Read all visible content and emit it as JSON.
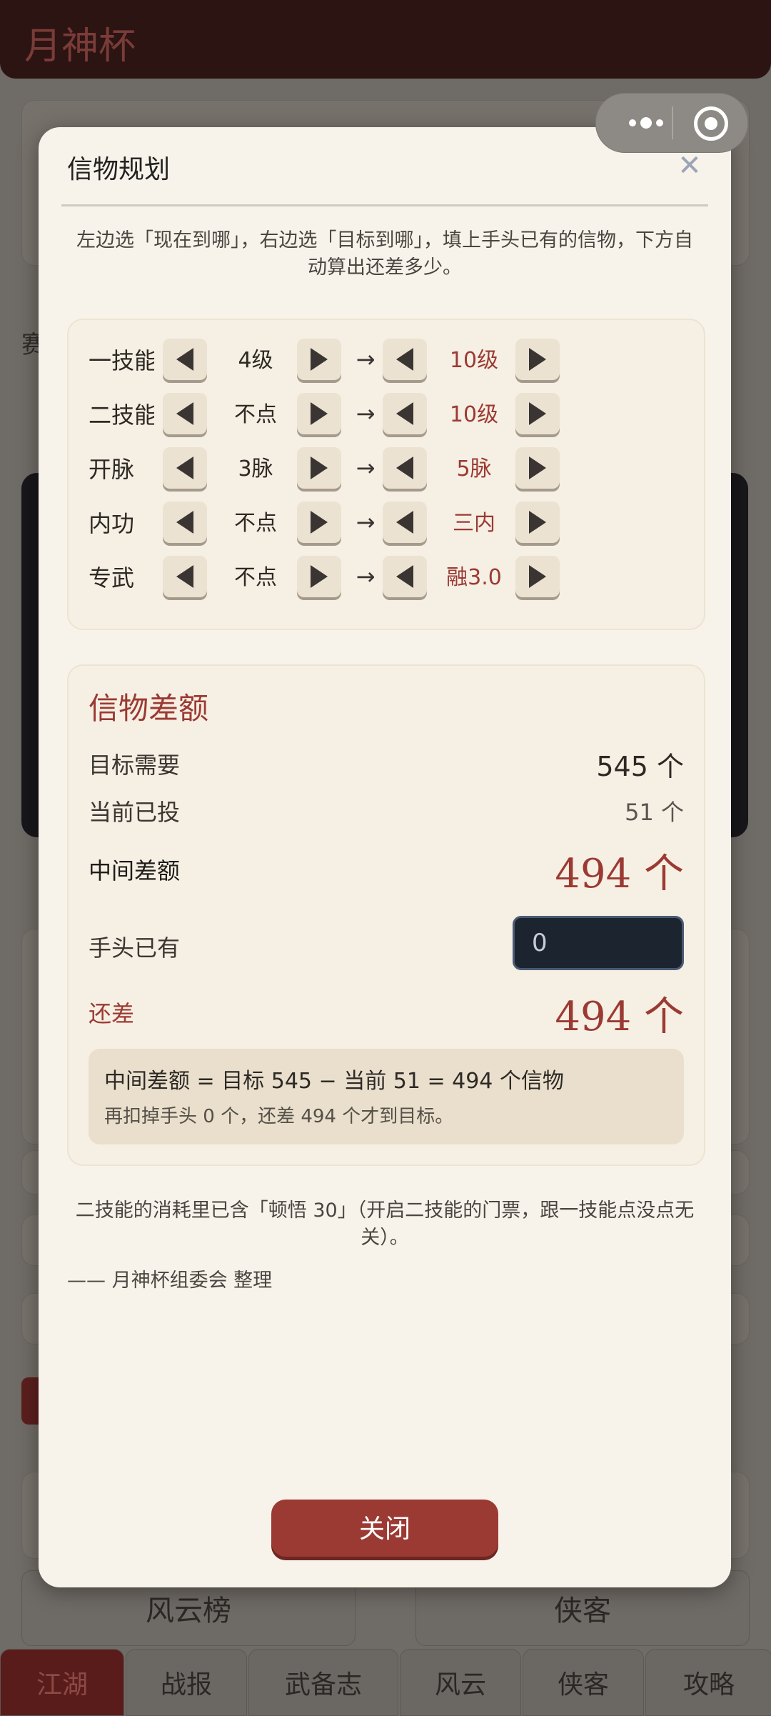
{
  "app": {
    "title": "月神杯",
    "side_fragment": "赛",
    "bottom_buttons": [
      "风云榜",
      "侠客"
    ],
    "tabs": [
      "江湖",
      "战报",
      "武备志",
      "风云",
      "侠客",
      "攻略"
    ],
    "active_tab": "江湖"
  },
  "capsule": {
    "menu_icon": "more-dots-icon",
    "close_icon": "target-icon"
  },
  "modal": {
    "title": "信物规划",
    "close_glyph": "✕",
    "intro": "左边选「现在到哪」，右边选「目标到哪」，填上手头已有的信物，下方自动算出还差多少。",
    "selector_arrow": "→",
    "selectors": [
      {
        "label": "一技能",
        "current": "4级",
        "target": "10级"
      },
      {
        "label": "二技能",
        "current": "不点",
        "target": "10级"
      },
      {
        "label": "开脉",
        "current": "3脉",
        "target": "5脉"
      },
      {
        "label": "内功",
        "current": "不点",
        "target": "三内"
      },
      {
        "label": "专武",
        "current": "不点",
        "target": "融3.0"
      }
    ],
    "diff": {
      "title": "信物差额",
      "need_label": "目标需要",
      "need_value": "545 个",
      "invested_label": "当前已投",
      "invested_value": "51 个",
      "gap_label": "中间差额",
      "gap_value": "494 个",
      "holding_label": "手头已有",
      "holding_placeholder": "0",
      "remaining_label": "还差",
      "remaining_value": "494 个",
      "formula_main": "中间差额 = 目标 545 − 当前 51 = 494 个信物",
      "formula_sub": "再扣掉手头 0 个，还差 494 个才到目标。"
    },
    "note": "二技能的消耗里已含「顿悟 30」（开启二技能的门票，跟一技能点没点无关）。",
    "credit": "—— 月神杯组委会 整理",
    "close_button": "关闭"
  },
  "colors": {
    "accent": "#9b3a33",
    "modal_bg": "#f8f3ea",
    "input_bg": "#1c2430"
  }
}
